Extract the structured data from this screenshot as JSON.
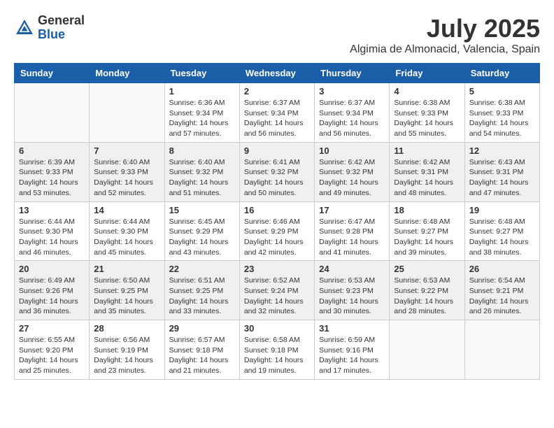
{
  "header": {
    "logo_general": "General",
    "logo_blue": "Blue",
    "month_year": "July 2025",
    "location": "Algimia de Almonacid, Valencia, Spain"
  },
  "days_of_week": [
    "Sunday",
    "Monday",
    "Tuesday",
    "Wednesday",
    "Thursday",
    "Friday",
    "Saturday"
  ],
  "weeks": [
    {
      "shaded": false,
      "days": [
        {
          "number": "",
          "info": ""
        },
        {
          "number": "",
          "info": ""
        },
        {
          "number": "1",
          "info": "Sunrise: 6:36 AM\nSunset: 9:34 PM\nDaylight: 14 hours and 57 minutes."
        },
        {
          "number": "2",
          "info": "Sunrise: 6:37 AM\nSunset: 9:34 PM\nDaylight: 14 hours and 56 minutes."
        },
        {
          "number": "3",
          "info": "Sunrise: 6:37 AM\nSunset: 9:34 PM\nDaylight: 14 hours and 56 minutes."
        },
        {
          "number": "4",
          "info": "Sunrise: 6:38 AM\nSunset: 9:33 PM\nDaylight: 14 hours and 55 minutes."
        },
        {
          "number": "5",
          "info": "Sunrise: 6:38 AM\nSunset: 9:33 PM\nDaylight: 14 hours and 54 minutes."
        }
      ]
    },
    {
      "shaded": true,
      "days": [
        {
          "number": "6",
          "info": "Sunrise: 6:39 AM\nSunset: 9:33 PM\nDaylight: 14 hours and 53 minutes."
        },
        {
          "number": "7",
          "info": "Sunrise: 6:40 AM\nSunset: 9:33 PM\nDaylight: 14 hours and 52 minutes."
        },
        {
          "number": "8",
          "info": "Sunrise: 6:40 AM\nSunset: 9:32 PM\nDaylight: 14 hours and 51 minutes."
        },
        {
          "number": "9",
          "info": "Sunrise: 6:41 AM\nSunset: 9:32 PM\nDaylight: 14 hours and 50 minutes."
        },
        {
          "number": "10",
          "info": "Sunrise: 6:42 AM\nSunset: 9:32 PM\nDaylight: 14 hours and 49 minutes."
        },
        {
          "number": "11",
          "info": "Sunrise: 6:42 AM\nSunset: 9:31 PM\nDaylight: 14 hours and 48 minutes."
        },
        {
          "number": "12",
          "info": "Sunrise: 6:43 AM\nSunset: 9:31 PM\nDaylight: 14 hours and 47 minutes."
        }
      ]
    },
    {
      "shaded": false,
      "days": [
        {
          "number": "13",
          "info": "Sunrise: 6:44 AM\nSunset: 9:30 PM\nDaylight: 14 hours and 46 minutes."
        },
        {
          "number": "14",
          "info": "Sunrise: 6:44 AM\nSunset: 9:30 PM\nDaylight: 14 hours and 45 minutes."
        },
        {
          "number": "15",
          "info": "Sunrise: 6:45 AM\nSunset: 9:29 PM\nDaylight: 14 hours and 43 minutes."
        },
        {
          "number": "16",
          "info": "Sunrise: 6:46 AM\nSunset: 9:29 PM\nDaylight: 14 hours and 42 minutes."
        },
        {
          "number": "17",
          "info": "Sunrise: 6:47 AM\nSunset: 9:28 PM\nDaylight: 14 hours and 41 minutes."
        },
        {
          "number": "18",
          "info": "Sunrise: 6:48 AM\nSunset: 9:27 PM\nDaylight: 14 hours and 39 minutes."
        },
        {
          "number": "19",
          "info": "Sunrise: 6:48 AM\nSunset: 9:27 PM\nDaylight: 14 hours and 38 minutes."
        }
      ]
    },
    {
      "shaded": true,
      "days": [
        {
          "number": "20",
          "info": "Sunrise: 6:49 AM\nSunset: 9:26 PM\nDaylight: 14 hours and 36 minutes."
        },
        {
          "number": "21",
          "info": "Sunrise: 6:50 AM\nSunset: 9:25 PM\nDaylight: 14 hours and 35 minutes."
        },
        {
          "number": "22",
          "info": "Sunrise: 6:51 AM\nSunset: 9:25 PM\nDaylight: 14 hours and 33 minutes."
        },
        {
          "number": "23",
          "info": "Sunrise: 6:52 AM\nSunset: 9:24 PM\nDaylight: 14 hours and 32 minutes."
        },
        {
          "number": "24",
          "info": "Sunrise: 6:53 AM\nSunset: 9:23 PM\nDaylight: 14 hours and 30 minutes."
        },
        {
          "number": "25",
          "info": "Sunrise: 6:53 AM\nSunset: 9:22 PM\nDaylight: 14 hours and 28 minutes."
        },
        {
          "number": "26",
          "info": "Sunrise: 6:54 AM\nSunset: 9:21 PM\nDaylight: 14 hours and 26 minutes."
        }
      ]
    },
    {
      "shaded": false,
      "days": [
        {
          "number": "27",
          "info": "Sunrise: 6:55 AM\nSunset: 9:20 PM\nDaylight: 14 hours and 25 minutes."
        },
        {
          "number": "28",
          "info": "Sunrise: 6:56 AM\nSunset: 9:19 PM\nDaylight: 14 hours and 23 minutes."
        },
        {
          "number": "29",
          "info": "Sunrise: 6:57 AM\nSunset: 9:18 PM\nDaylight: 14 hours and 21 minutes."
        },
        {
          "number": "30",
          "info": "Sunrise: 6:58 AM\nSunset: 9:18 PM\nDaylight: 14 hours and 19 minutes."
        },
        {
          "number": "31",
          "info": "Sunrise: 6:59 AM\nSunset: 9:16 PM\nDaylight: 14 hours and 17 minutes."
        },
        {
          "number": "",
          "info": ""
        },
        {
          "number": "",
          "info": ""
        }
      ]
    }
  ]
}
